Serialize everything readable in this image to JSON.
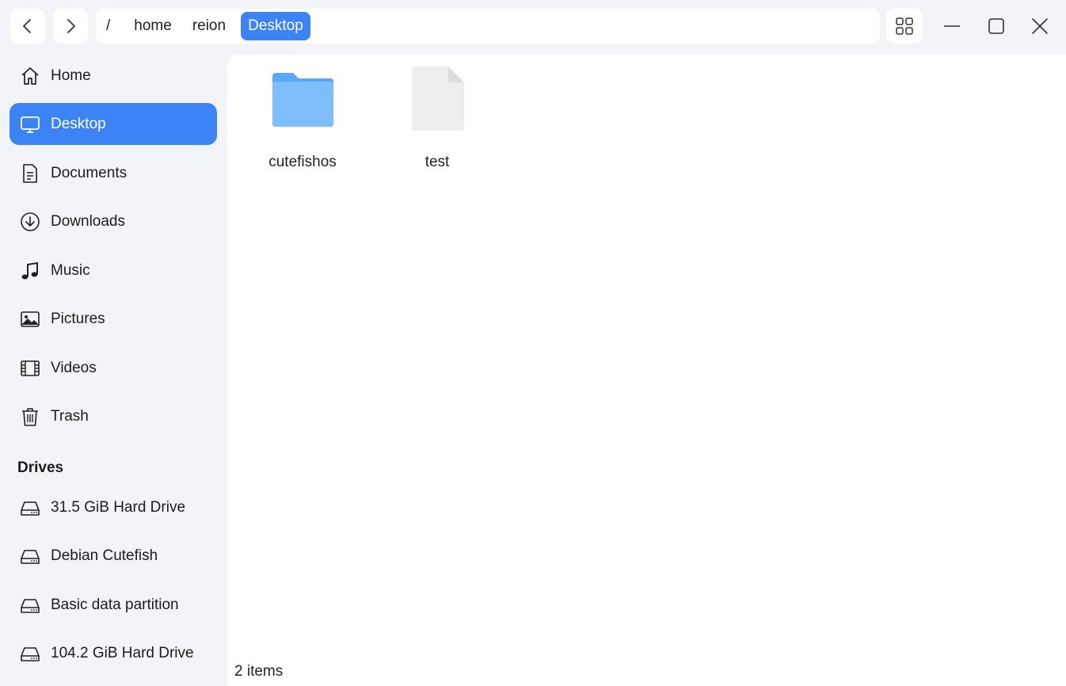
{
  "colors": {
    "accent": "#3c84f6",
    "folder": "#74b7fb",
    "background": "#f3f4f7",
    "content_background": "#ffffff"
  },
  "toolbar": {
    "back_icon": "chevron-left-icon",
    "forward_icon": "chevron-right-icon",
    "view_mode_icon": "grid-view-icon"
  },
  "breadcrumb": {
    "root": "/",
    "segments": [
      "home",
      "reion"
    ],
    "current": "Desktop"
  },
  "window_controls": [
    "minimize-icon",
    "maximize-icon",
    "close-icon"
  ],
  "sidebar": {
    "items": [
      {
        "label": "Home",
        "icon": "home-icon"
      },
      {
        "label": "Desktop",
        "icon": "desktop-icon",
        "active": true
      },
      {
        "label": "Documents",
        "icon": "document-icon"
      },
      {
        "label": "Downloads",
        "icon": "download-icon"
      },
      {
        "label": "Music",
        "icon": "music-icon"
      },
      {
        "label": "Pictures",
        "icon": "picture-icon"
      },
      {
        "label": "Videos",
        "icon": "video-icon"
      },
      {
        "label": "Trash",
        "icon": "trash-icon"
      }
    ],
    "drives_heading": "Drives",
    "drives": [
      {
        "label": "31.5 GiB Hard Drive",
        "icon": "hard-drive-icon"
      },
      {
        "label": "Debian Cutefish",
        "icon": "hard-drive-icon"
      },
      {
        "label": "Basic data partition",
        "icon": "hard-drive-icon"
      },
      {
        "label": "104.2 GiB Hard Drive",
        "icon": "hard-drive-icon"
      }
    ]
  },
  "files": [
    {
      "name": "cutefishos",
      "type": "folder",
      "icon": "folder-icon"
    },
    {
      "name": "test",
      "type": "file",
      "icon": "file-icon"
    }
  ],
  "status": {
    "item_count": "2 items"
  }
}
